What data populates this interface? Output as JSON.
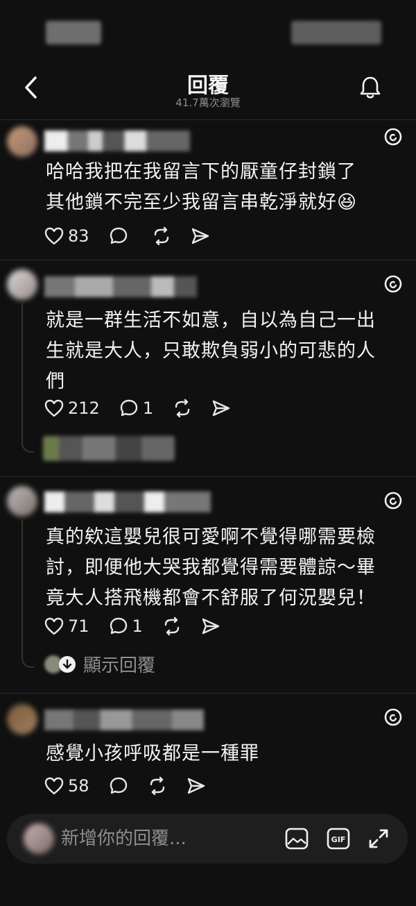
{
  "header": {
    "title": "回覆",
    "subtitle": "41.7萬次瀏覽"
  },
  "comments": [
    {
      "text_lines": [
        "哈哈我把在我留言下的厭童仔封鎖了",
        "其他鎖不完至少我留言串乾淨就好😆"
      ],
      "likes": "83",
      "replies": ""
    },
    {
      "text_lines": [
        "就是一群生活不如意，自以為自己一出",
        "生就是大人，只敢欺負弱小的可悲的人",
        "們"
      ],
      "likes": "212",
      "replies": "1"
    },
    {
      "text_lines": [
        "真的欸這嬰兒很可愛啊不覺得哪需要檢",
        "討，即便他大哭我都覺得需要體諒～畢",
        "竟大人搭飛機都會不舒服了何況嬰兒！"
      ],
      "likes": "71",
      "replies": "1",
      "show_replies_label": "顯示回覆"
    },
    {
      "text_lines": [
        "感覺小孩呼吸都是一種罪"
      ],
      "likes": "58",
      "replies": ""
    }
  ],
  "reply_bar": {
    "placeholder": "新增你的回覆..."
  },
  "icons": {
    "back": "chevron-left-icon",
    "bell": "bell-icon",
    "threads": "threads-logo-icon",
    "like": "heart-icon",
    "comment": "comment-icon",
    "repost": "repost-icon",
    "share": "send-icon",
    "image": "image-icon",
    "gif": "gif-icon",
    "expand": "expand-icon"
  },
  "colors": {
    "background": "#101010",
    "text": "#f3f3f3",
    "muted": "#8e8e8e"
  }
}
